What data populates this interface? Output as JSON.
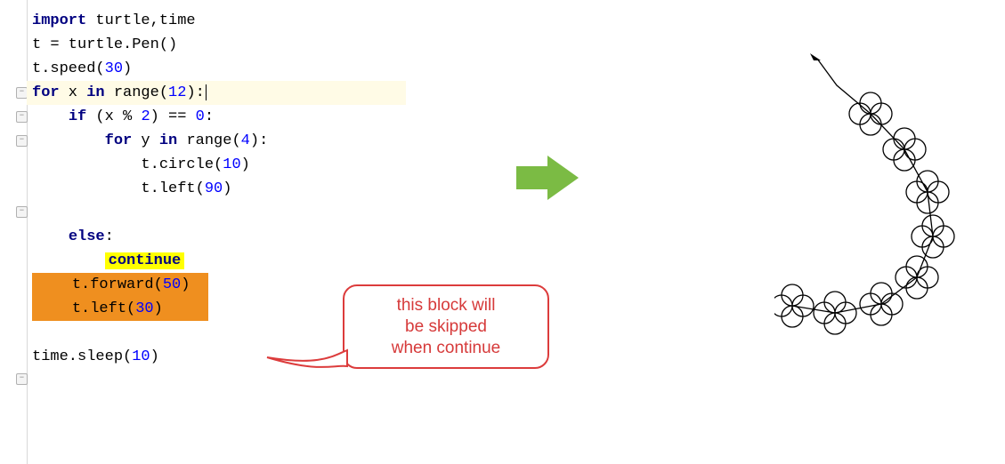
{
  "code": {
    "l1_kw": "import",
    "l1_rest": " turtle,time",
    "l2": "t = turtle.Pen()",
    "l3_a": "t.speed(",
    "l3_num": "30",
    "l3_b": ")",
    "l4_kw1": "for",
    "l4_mid": " x ",
    "l4_kw2": "in",
    "l4_rest": " range(",
    "l4_num": "12",
    "l4_end": "):",
    "l5_kw": "if",
    "l5_a": " (x % ",
    "l5_n1": "2",
    "l5_b": ") == ",
    "l5_n2": "0",
    "l5_c": ":",
    "l6_kw1": "for",
    "l6_mid": " y ",
    "l6_kw2": "in",
    "l6_rest": " range(",
    "l6_num": "4",
    "l6_end": "):",
    "l7_a": "t.circle(",
    "l7_num": "10",
    "l7_b": ")",
    "l8_a": "t.left(",
    "l8_num": "90",
    "l8_b": ")",
    "l10_kw": "else",
    "l10_c": ":",
    "l11_kw": "continue",
    "l12_a": "t.forward(",
    "l12_num": "50",
    "l12_b": ")",
    "l13_a": "t.left(",
    "l13_num": "30",
    "l13_b": ")",
    "l15_a": "time.sleep(",
    "l15_num": "10",
    "l15_b": ")"
  },
  "callout": {
    "line1": "this block will",
    "line2": "be skipped",
    "line3": "when continue"
  }
}
